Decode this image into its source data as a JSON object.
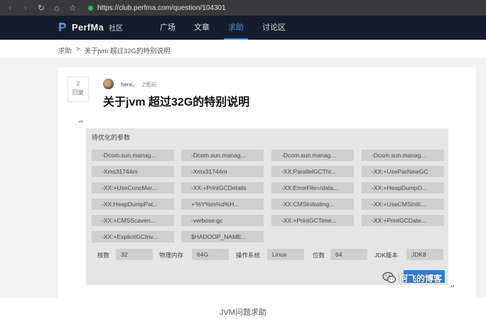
{
  "browser": {
    "back_icon": "‹",
    "forward_icon": "›",
    "reload_icon": "↻",
    "home_icon": "⌂",
    "bookmark_icon": "☆",
    "url": "https://club.perfma.com/question/104301"
  },
  "header": {
    "logo_text": "PerfMa",
    "logo_sub": "社区",
    "nav": [
      "广场",
      "文章",
      "求助",
      "讨论区"
    ],
    "active_nav": "求助",
    "accent_color": "#4a90e2",
    "bg_color": "#141d2b"
  },
  "breadcrumb": {
    "parent": "求助",
    "separator": ">",
    "current": "关于jvm 超过32G的特别说明"
  },
  "question": {
    "answers_count": "2",
    "answers_label": "回复",
    "author": "here。",
    "time": "2周前",
    "title": "关于jvm 超过32G的特别说明"
  },
  "panel": {
    "title": "待优化的参数",
    "tags": [
      "-Dcom.sun.manag...",
      "-Dcom.sun.manag...",
      "-Dcom.sun.manag...",
      "-Dcom.sun.manag...",
      "-Xms31744m",
      "-Xmx31744m",
      "-XX:ParallelGCThr...",
      "-XX:+UseParNewGC",
      "-XX:+UseConcMar...",
      "-XX:+PrintGCDetails",
      "-XX:ErrorFile=/data...",
      "-XX:+HeapDumpO...",
      "-XX:HeapDumpPat...",
      "+'%Y%m%d%H...",
      "-XX:CMSInitiating...",
      "-XX:+UseCMSIniti...",
      "-XX:+CMSScaven...",
      "-verbose:gc",
      "-XX:+PrintGCTime...",
      "-XX:+PrintGCDate...",
      "-XX:+ExplicitGCInv...",
      "$HADOOP_NAME..."
    ],
    "info": {
      "cores_label": "核数",
      "cores": "32",
      "memory_label": "物理内存",
      "memory": "64G",
      "os_label": "操作系统",
      "os": "Linux",
      "bits_label": "位数",
      "bits": "64",
      "jdk_label": "JDK版本",
      "jdk": "JDK8"
    }
  },
  "watermark": "阿飞的博客",
  "caption": "JVM问题求助"
}
